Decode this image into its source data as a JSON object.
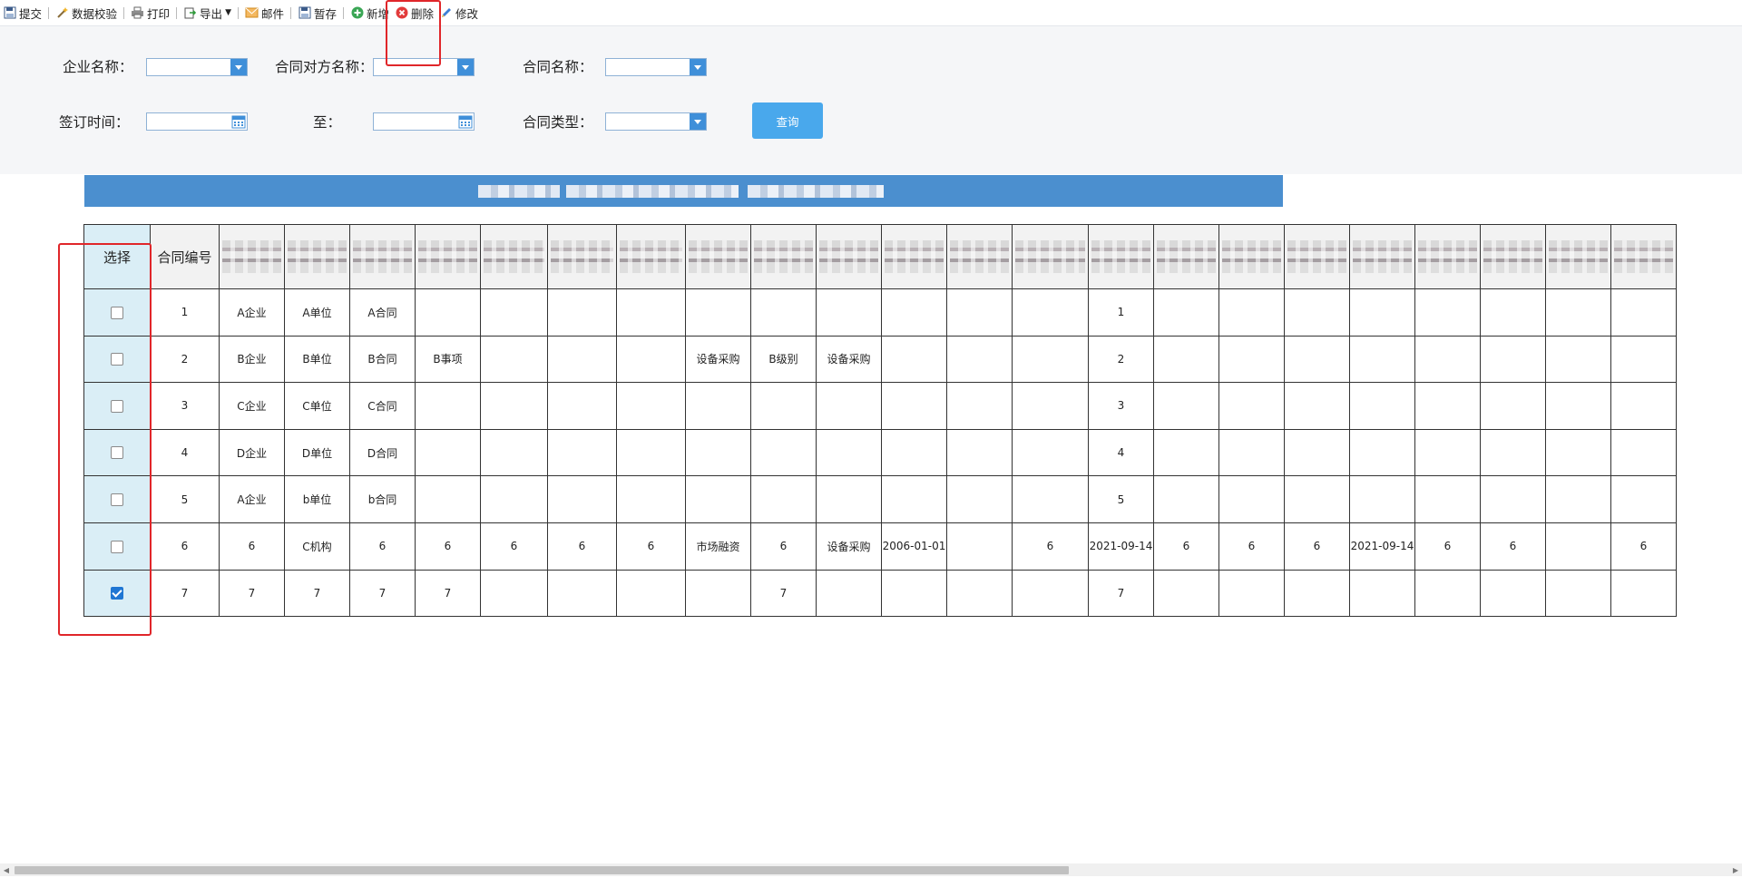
{
  "toolbar": {
    "buttons": [
      {
        "label": "提交",
        "icon": "save-icon"
      },
      {
        "label": "数据校验",
        "icon": "wand-icon"
      },
      {
        "label": "打印",
        "icon": "printer-icon"
      },
      {
        "label": "导出",
        "icon": "export-icon"
      },
      {
        "label": "邮件",
        "icon": "mail-icon"
      },
      {
        "label": "暂存",
        "icon": "save-icon"
      },
      {
        "label": "新增",
        "icon": "add-icon"
      },
      {
        "label": "删除",
        "icon": "delete-icon"
      },
      {
        "label": "修改",
        "icon": "edit-icon"
      }
    ]
  },
  "filters": {
    "company_label": "企业名称：",
    "counterparty_label": "合同对方名称：",
    "contract_name_label": "合同名称：",
    "sign_time_label": "签订时间：",
    "to_label": "至：",
    "contract_type_label": "合同类型：",
    "query_label": "查询",
    "company_value": "",
    "counterparty_value": "",
    "contract_name_value": "",
    "sign_from_value": "",
    "sign_to_value": "",
    "contract_type_value": ""
  },
  "table": {
    "headers": [
      "选择",
      "合同编号"
    ],
    "rows": [
      {
        "checked": false,
        "cells": [
          "1",
          "A企业",
          "A单位",
          "A合同",
          "",
          "",
          "",
          "",
          "",
          "",
          "",
          "",
          "",
          "",
          "1",
          "",
          "",
          "",
          "",
          "",
          "",
          "",
          ""
        ]
      },
      {
        "checked": false,
        "cells": [
          "2",
          "B企业",
          "B单位",
          "B合同",
          "B事项",
          "",
          "",
          "",
          "设备采购",
          "B级别",
          "设备采购",
          "",
          "",
          "",
          "2",
          "",
          "",
          "",
          "",
          "",
          "",
          "",
          ""
        ]
      },
      {
        "checked": false,
        "cells": [
          "3",
          "C企业",
          "C单位",
          "C合同",
          "",
          "",
          "",
          "",
          "",
          "",
          "",
          "",
          "",
          "",
          "3",
          "",
          "",
          "",
          "",
          "",
          "",
          "",
          ""
        ]
      },
      {
        "checked": false,
        "cells": [
          "4",
          "D企业",
          "D单位",
          "D合同",
          "",
          "",
          "",
          "",
          "",
          "",
          "",
          "",
          "",
          "",
          "4",
          "",
          "",
          "",
          "",
          "",
          "",
          "",
          ""
        ]
      },
      {
        "checked": false,
        "cells": [
          "5",
          "A企业",
          "b单位",
          "b合同",
          "",
          "",
          "",
          "",
          "",
          "",
          "",
          "",
          "",
          "",
          "5",
          "",
          "",
          "",
          "",
          "",
          "",
          "",
          ""
        ]
      },
      {
        "checked": false,
        "cells": [
          "6",
          "6",
          "C机构",
          "6",
          "6",
          "6",
          "6",
          "6",
          "市场融资",
          "6",
          "设备采购",
          "2006-01-01",
          "",
          "6",
          "2021-09-14",
          "6",
          "6",
          "6",
          "2021-09-14",
          "6",
          "6",
          "",
          "6"
        ]
      },
      {
        "checked": true,
        "cells": [
          "7",
          "7",
          "7",
          "7",
          "7",
          "",
          "",
          "",
          "",
          "7",
          "",
          "",
          "",
          "",
          "7",
          "",
          "",
          "",
          "",
          "",
          "",
          "",
          ""
        ]
      }
    ]
  },
  "colors": {
    "accent": "#4b8fcf",
    "query_button": "#49a8ec",
    "highlight": "#e0262a",
    "select_column": "#daeef6"
  }
}
